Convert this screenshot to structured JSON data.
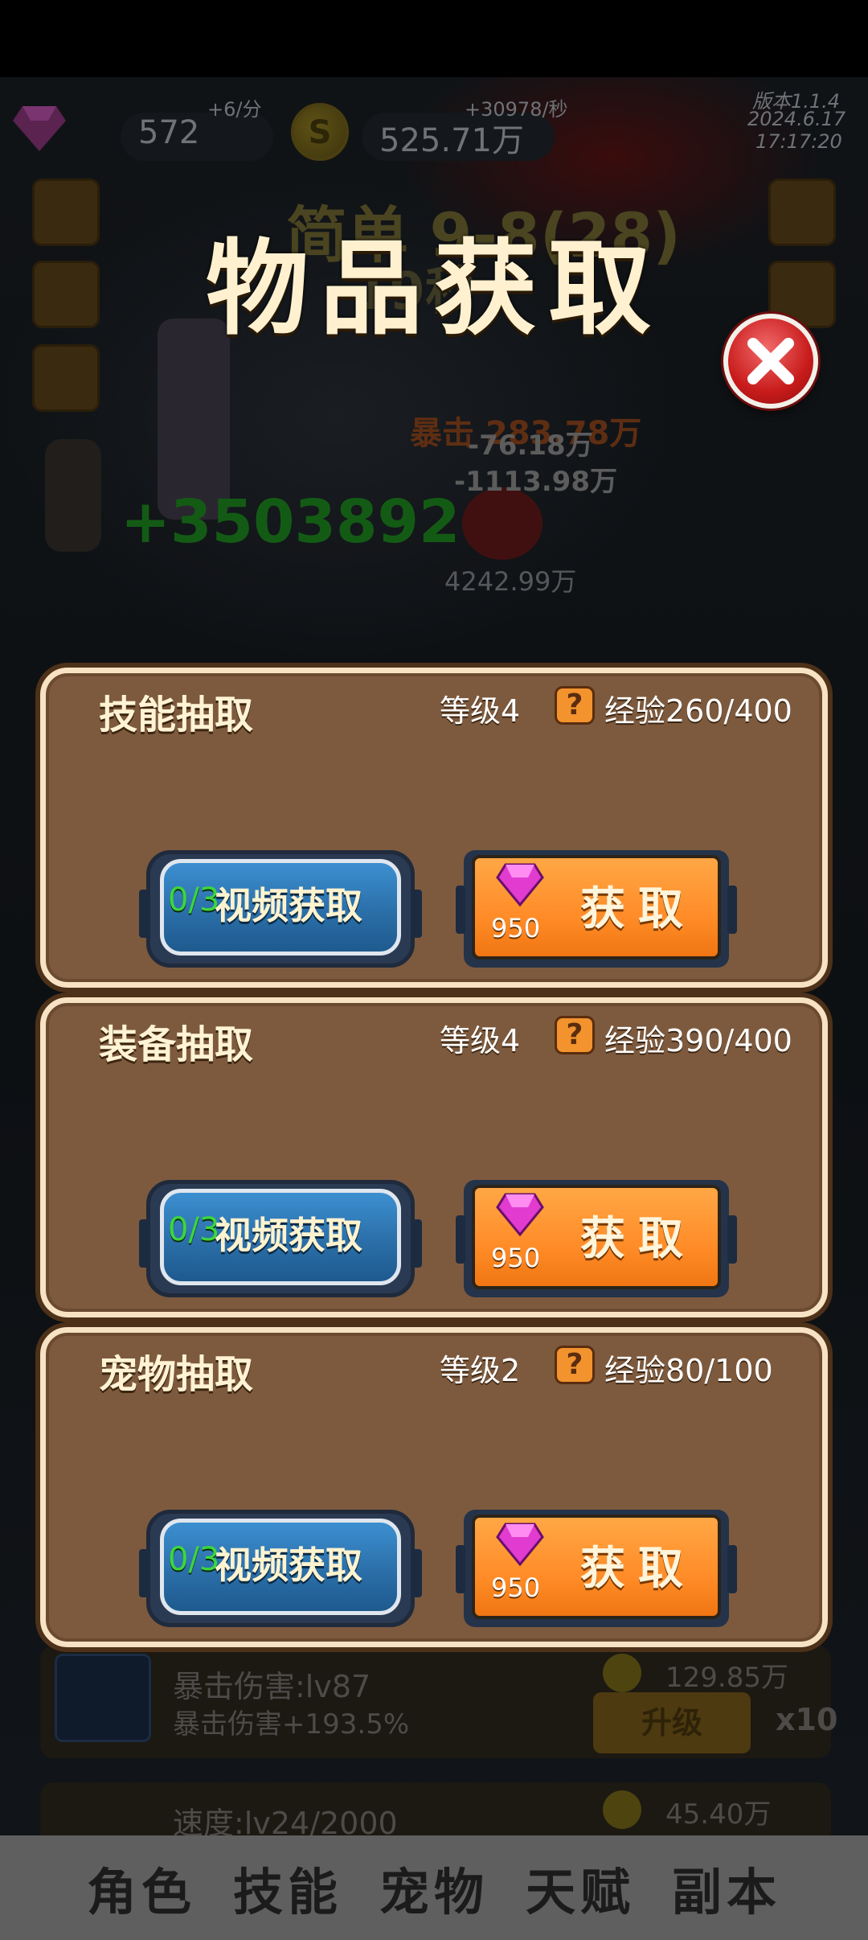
{
  "hud": {
    "gems": "572",
    "gem_rate": "+6/分",
    "coins": "525.71万",
    "coin_rate": "+30978/秒",
    "version": "版本1.1.4",
    "date": "2024.6.17",
    "time": "17:17:20"
  },
  "scene": {
    "stage_text": "简单 9-8(28)",
    "timer_text": "19秒",
    "crit_text": "暴击 283.78万",
    "damage_1": "-76.18万",
    "damage_2": "-1113.98万",
    "enemy_hp": "4242.99万",
    "heal_text": "+3503892"
  },
  "modal": {
    "title": "物品获取",
    "close_label": "close",
    "panels": [
      {
        "name": "技能抽取",
        "level": "等级4",
        "exp": "经验260/400",
        "video_count": "0/3",
        "video_label": "视频获取",
        "gem_cost": "950",
        "get_label": "获取"
      },
      {
        "name": "装备抽取",
        "level": "等级4",
        "exp": "经验390/400",
        "video_count": "0/3",
        "video_label": "视频获取",
        "gem_cost": "950",
        "get_label": "获取"
      },
      {
        "name": "宠物抽取",
        "level": "等级2",
        "exp": "经验80/100",
        "video_count": "0/3",
        "video_label": "视频获取",
        "gem_cost": "950",
        "get_label": "获取"
      }
    ],
    "help_glyph": "?"
  },
  "background_list": [
    {
      "title": "暴击伤害:lv87",
      "desc": "暴击伤害+193.5%",
      "cost": "129.85万",
      "button": "升级",
      "mult": "x10"
    },
    {
      "title": "速度:lv24/2000",
      "cost": "45.40万"
    }
  ],
  "bottom_nav": {
    "tabs": [
      "角色",
      "技能",
      "宠物",
      "天赋",
      "副本"
    ]
  },
  "colors": {
    "panel_bg": "#7d5a3e",
    "panel_border": "#f7e3c4",
    "video_button": "#2b6fa9",
    "get_button": "#ff8c28",
    "close_button": "#c81b1b",
    "title_text": "#fff1cf"
  }
}
